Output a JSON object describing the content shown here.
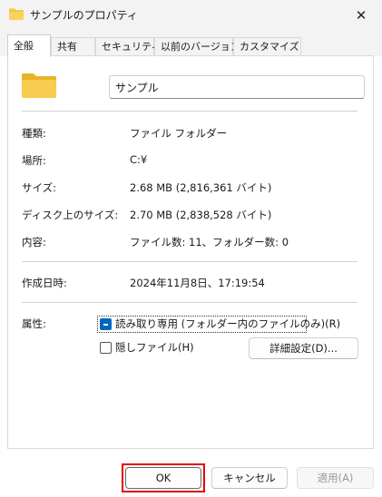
{
  "window": {
    "title": "サンプルのプロパティ",
    "close_glyph": "✕"
  },
  "tabs": [
    {
      "label": "全般",
      "active": true
    },
    {
      "label": "共有"
    },
    {
      "label": "セキュリティ"
    },
    {
      "label": "以前のバージョン"
    },
    {
      "label": "カスタマイズ"
    }
  ],
  "general": {
    "folder_name": "サンプル",
    "rows": [
      {
        "label": "種類:",
        "value": "ファイル フォルダー"
      },
      {
        "label": "場所:",
        "value": "C:¥"
      },
      {
        "label": "サイズ:",
        "value": "2.68 MB (2,816,361 バイト)"
      },
      {
        "label": "ディスク上のサイズ:",
        "value": "2.70 MB (2,838,528 バイト)"
      },
      {
        "label": "内容:",
        "value": "ファイル数: 11、フォルダー数: 0"
      },
      {
        "label": "作成日時:",
        "value": "2024年11月8日、17:19:54"
      }
    ],
    "attributes_label": "属性:",
    "readonly_label": "読み取り専用 (フォルダー内のファイルのみ)(R)",
    "hidden_label": "隠しファイル(H)",
    "advanced_button": "詳細設定(D)..."
  },
  "buttons": {
    "ok": "OK",
    "cancel": "キャンセル",
    "apply": "適用(A)"
  },
  "colors": {
    "accent": "#0067c0",
    "folder": "#f3c744",
    "highlight": "#e00000"
  }
}
